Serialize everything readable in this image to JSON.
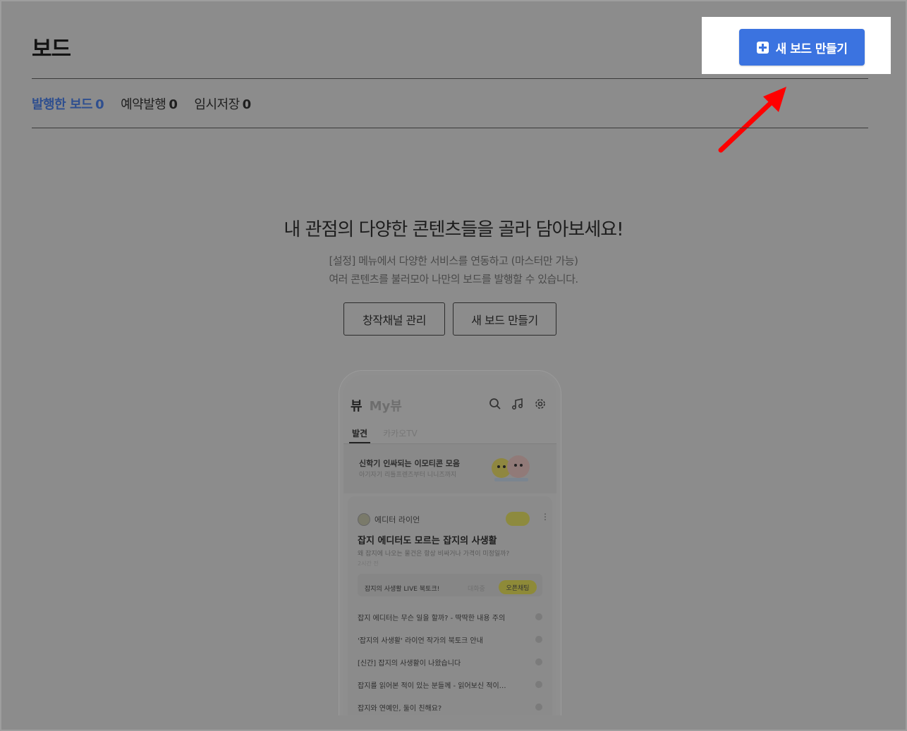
{
  "page": {
    "title": "보드"
  },
  "header": {
    "create_button_label": "새 보드 만들기"
  },
  "tabs": [
    {
      "label": "발행한 보드",
      "count": "0"
    },
    {
      "label": "예약발행",
      "count": "0"
    },
    {
      "label": "임시저장",
      "count": "0"
    }
  ],
  "empty_state": {
    "headline": "내 관점의 다양한 콘텐츠들을 골라 담아보세요!",
    "desc_line1": "[설정] 메뉴에서 다양한 서비스를 연동하고 (마스터만 가능)",
    "desc_line2": "여러 콘텐츠를 불러모아 나만의 보드를 발행할 수 있습니다.",
    "button_manage": "창작채널 관리",
    "button_create": "새 보드 만들기"
  },
  "phone": {
    "logo": "뷰",
    "my_logo": "My뷰",
    "tabs": [
      "발견",
      "카카오TV"
    ],
    "banner_title": "신학기 인싸되는 이모티콘 모음",
    "banner_sub": "아기자기 리틀프렌즈부터 니니즈까지",
    "author": "에디터 라이언",
    "article_title": "잡지 에디터도 모르는 잡지의 사생활",
    "article_sub": "왜 잡지에 나오는 물건은 항상 비싸거나 가격이 미정일까?",
    "article_time": "2시간 전",
    "live_text": "잡지의 사생활 LIVE 북토크!",
    "live_count": "대화중",
    "open_button": "오픈채팅",
    "list": [
      "잡지 에디터는 무슨 일을 할까? - 딱딱한 내용 주의",
      "'잡지의 사생활' 라이언 작가의 북토크 안내",
      "[신간] 잡지의 사생활이 나왔습니다",
      "잡지를 읽어본 적이 있는 분들께 - 읽어보신 적이…",
      "잡지와 연예인, 둘이 친해요?"
    ]
  },
  "colors": {
    "accent": "#3b73e0",
    "overlay_bg": "#8c8c8c",
    "active_tab": "#2f4f8f",
    "annotation_arrow": "#ff0000"
  }
}
